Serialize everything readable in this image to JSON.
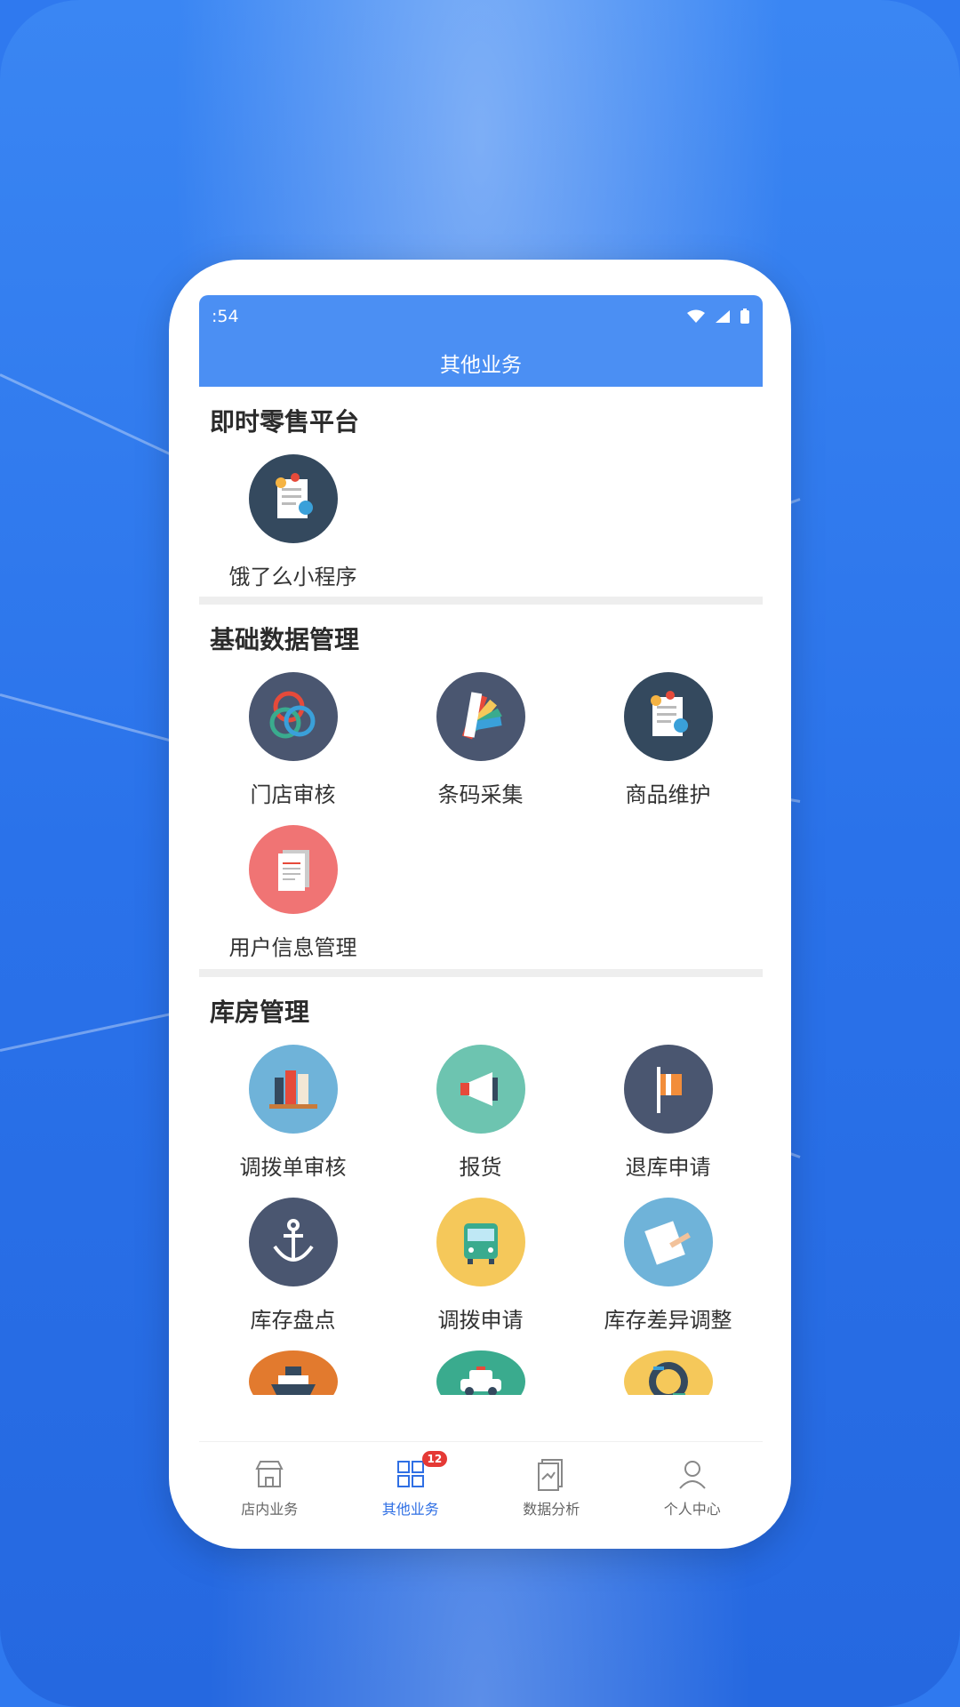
{
  "status": {
    "time": ":54"
  },
  "header": {
    "title": "其他业务"
  },
  "sections": [
    {
      "title": "即时零售平台",
      "items": [
        {
          "label": "饿了么小程序",
          "icon": "document-gear-icon",
          "color": "#34495e"
        }
      ]
    },
    {
      "title": "基础数据管理",
      "items": [
        {
          "label": "门店审核",
          "icon": "rings-icon",
          "color": "#4a5670"
        },
        {
          "label": "条码采集",
          "icon": "color-swatch-icon",
          "color": "#4a5670"
        },
        {
          "label": "商品维护",
          "icon": "document-gear-icon",
          "color": "#34495e"
        },
        {
          "label": "用户信息管理",
          "icon": "document-stack-icon",
          "color": "#f07474"
        }
      ]
    },
    {
      "title": "库房管理",
      "items": [
        {
          "label": "调拨单审核",
          "icon": "books-icon",
          "color": "#6fb3d9"
        },
        {
          "label": "报货",
          "icon": "megaphone-icon",
          "color": "#6dc4b0"
        },
        {
          "label": "退库申请",
          "icon": "door-icon",
          "color": "#4a5670"
        },
        {
          "label": "库存盘点",
          "icon": "anchor-icon",
          "color": "#4a5670"
        },
        {
          "label": "调拨申请",
          "icon": "bus-icon",
          "color": "#f5c85a"
        },
        {
          "label": "库存差异调整",
          "icon": "clipboard-pen-icon",
          "color": "#6fb3d9"
        },
        {
          "label": "",
          "icon": "ship-icon",
          "color": "#e27a2e"
        },
        {
          "label": "",
          "icon": "police-car-icon",
          "color": "#3aab8e"
        },
        {
          "label": "",
          "icon": "gear-arrows-icon",
          "color": "#f5c85a"
        }
      ]
    }
  ],
  "tabbar": {
    "tabs": [
      {
        "label": "店内业务",
        "icon": "store-icon"
      },
      {
        "label": "其他业务",
        "icon": "grid-icon",
        "active": true
      },
      {
        "label": "数据分析",
        "icon": "report-icon"
      },
      {
        "label": "个人中心",
        "icon": "person-icon"
      }
    ],
    "badge": "12"
  },
  "colors": {
    "accent": "#4b8ff3",
    "active_tab": "#2f6fe4",
    "badge": "#e53935"
  }
}
